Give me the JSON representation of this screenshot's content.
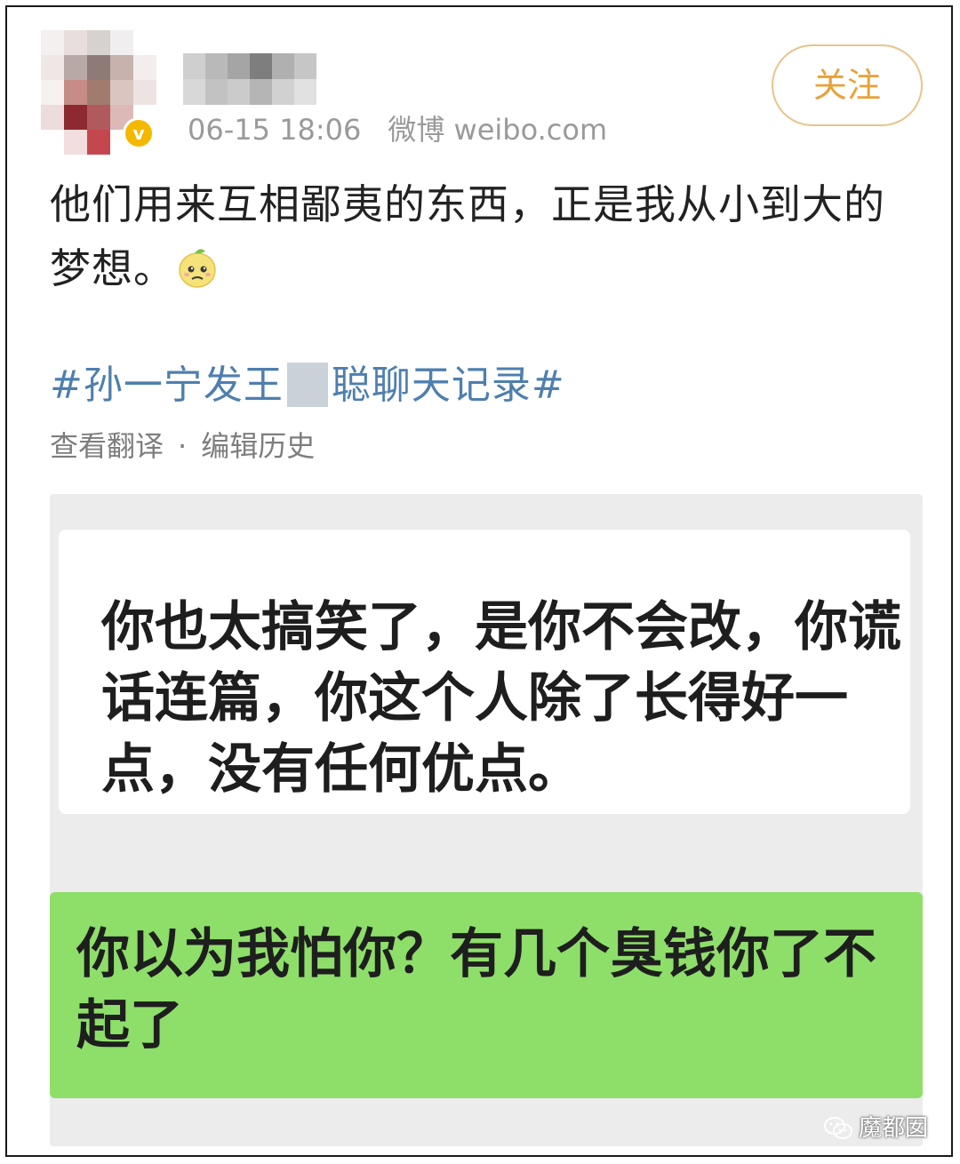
{
  "post": {
    "timestamp": "06-15 18:06",
    "source": "微博 weibo.com",
    "follow_label": "关注",
    "text_line1": "他们用来互相鄙夷的东西，正是我从小到大的",
    "text_line2": "梦想。",
    "hashtag_part1": "#孙一宁发王",
    "hashtag_part2": "聪聊天记录#",
    "action_translate": "查看翻译",
    "action_separator": "·",
    "action_history": "编辑历史"
  },
  "chat_image": {
    "received_message": "你也太搞笑了，是你不会改，你谎话连篇，你这个人除了长得好一点，没有任何优点。",
    "sent_message": "你以为我怕你？有几个臭钱你了不起了"
  },
  "watermark": {
    "text": "魔都囡",
    "icon": "wechat-icon"
  },
  "icons": {
    "verified_badge": "verified-v-icon",
    "emoji": "sad-lemon-emoji-icon"
  },
  "colors": {
    "follow_accent": "#e8a23a",
    "hashtag": "#4e7fae",
    "sent_bubble": "#8ede6a",
    "verified": "#f5b800"
  }
}
